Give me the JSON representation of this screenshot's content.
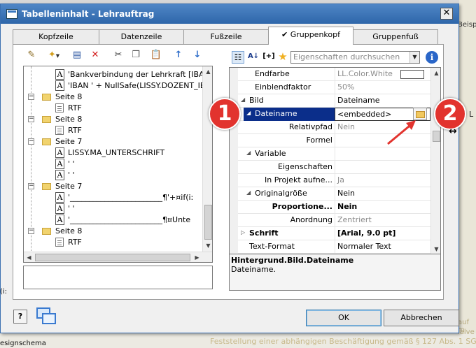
{
  "dialog": {
    "title": "Tabelleninhalt - Lehrauftrag",
    "tabs": [
      {
        "label": "Kopfzeile"
      },
      {
        "label": "Datenzeile"
      },
      {
        "label": "Fußzeile"
      },
      {
        "label": "Gruppenkopf",
        "active": true
      },
      {
        "label": "Gruppenfuß"
      }
    ],
    "tree": [
      {
        "type": "text",
        "text": "'Bankverbindung der Lehrkraft [IBAN"
      },
      {
        "type": "text",
        "text": "'IBAN ' +   NullSafe(LISSY.DOZENT_IB/"
      },
      {
        "type": "folder",
        "text": "Seite 8"
      },
      {
        "type": "rtf",
        "text": "RTF"
      },
      {
        "type": "folder",
        "text": "Seite 8"
      },
      {
        "type": "rtf",
        "text": "RTF"
      },
      {
        "type": "folder",
        "text": "Seite 7"
      },
      {
        "type": "text",
        "text": "LISSY.MA_UNTERSCHRIFT"
      },
      {
        "type": "text",
        "text": "' '"
      },
      {
        "type": "text",
        "text": "' '"
      },
      {
        "type": "folder",
        "text": "Seite 7"
      },
      {
        "type": "text",
        "text": "'________________________¶'+¤if(i:"
      },
      {
        "type": "text",
        "text": "' '"
      },
      {
        "type": "text",
        "text": "'________________________¶¤Unte"
      },
      {
        "type": "folder",
        "text": "Seite 8"
      },
      {
        "type": "rtf",
        "text": "RTF"
      }
    ],
    "search_placeholder": "Eigenschaften durchsuchen",
    "properties": [
      {
        "name": "Endfarbe",
        "value": "LL.Color.White",
        "dim": true,
        "indent": 2
      },
      {
        "name": "Einblendfaktor",
        "value": "50%",
        "dim": true,
        "indent": 2
      },
      {
        "name": "Bild",
        "value": "Dateiname",
        "indent": 1,
        "expander": "◢"
      },
      {
        "name": "Dateiname",
        "value": "<embedded>",
        "indent": 2,
        "selected": true,
        "expander": "◢"
      },
      {
        "name": "Relativpfad",
        "value": "Nein",
        "dim": true,
        "indent": 3,
        "right": true
      },
      {
        "name": "Formel",
        "value": "",
        "dim": true,
        "indent": 3,
        "right": true
      },
      {
        "name": "Variable",
        "value": "",
        "dim": true,
        "indent": 2,
        "expander": "◢"
      },
      {
        "name": "Eigenschaften",
        "value": "",
        "dim": true,
        "indent": 3,
        "right": true
      },
      {
        "name": "In Projekt aufne...",
        "value": "Ja",
        "dim": true,
        "indent": 3,
        "right": true
      },
      {
        "name": "Originalgröße",
        "value": "Nein",
        "indent": 2,
        "expander": "◢"
      },
      {
        "name": "Proportione...",
        "value": "Nein",
        "bold": true,
        "indent": 3,
        "right": true
      },
      {
        "name": "Anordnung",
        "value": "Zentriert",
        "dim": true,
        "indent": 3,
        "right": true
      },
      {
        "name": "Schrift",
        "value": "[Arial, 9.0 pt]",
        "bold": true,
        "indent": 1,
        "expander": "▷"
      },
      {
        "name": "Text-Format",
        "value": "Normaler Text",
        "indent": 1
      }
    ],
    "hint_title": "Hintergrund.Bild.Dateiname",
    "hint_text": "Dateiname.",
    "ok_label": "OK",
    "cancel_label": "Abbrechen",
    "help_label": "?"
  },
  "background": {
    "top_right_text": "Beisp",
    "right_text_1": "L",
    "bottom_text": "Feststellung einer abhängigen Beschäftigung gemäß § 127 Abs. 1 SGB",
    "bottom_right_text_1": "auf m",
    "bottom_right_text_2": "ialve",
    "bottom_left_text": "esignschema",
    "left_text": "(i:"
  },
  "callouts": [
    {
      "label": "1"
    },
    {
      "label": "2"
    }
  ]
}
